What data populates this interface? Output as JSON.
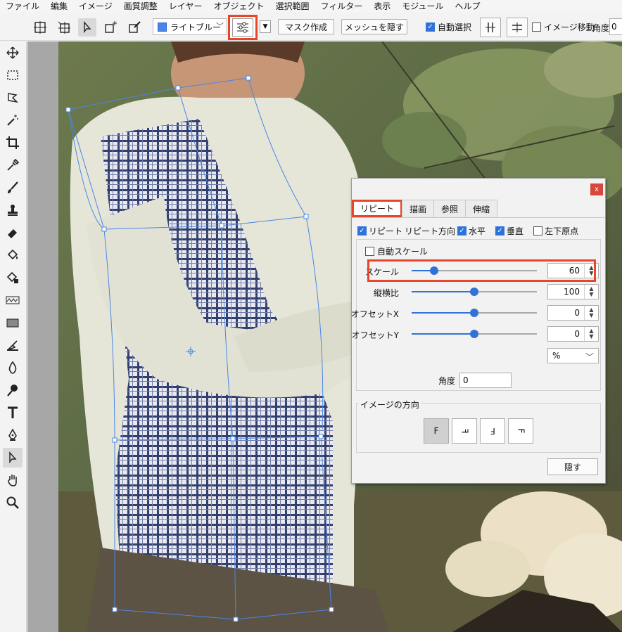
{
  "menu": [
    "ファイル",
    "編集",
    "イメージ",
    "画質調整",
    "レイヤー",
    "オブジェクト",
    "選択範囲",
    "フィルター",
    "表示",
    "モジュール",
    "ヘルプ"
  ],
  "toolbar": {
    "color_label": "ライトブルー",
    "color_value": "#4a86e8",
    "mask_button": "マスク作成",
    "mesh_button": "メッシュを隠す",
    "auto_select_label": "自動選択",
    "image_move_label": "イメージ移動",
    "angle_label": "角度",
    "angle_value": "0"
  },
  "dialog": {
    "close_glyph": "x",
    "tabs": [
      "リピート",
      "描画",
      "参照",
      "伸縮"
    ],
    "repeat_label": "リピート",
    "repeat_dir_label": "リピート方向",
    "horizontal_label": "水平",
    "vertical_label": "垂直",
    "bottom_left_label": "左下原点",
    "auto_scale_label": "自動スケール",
    "sliders": [
      {
        "label": "スケール",
        "value": "60",
        "level": 0.18
      },
      {
        "label": "縦横比",
        "value": "100",
        "level": 0.5
      },
      {
        "label": "オフセットX",
        "value": "0",
        "level": 0.5
      },
      {
        "label": "オフセットY",
        "value": "0",
        "level": 0.5
      }
    ],
    "unit": "%",
    "angle_label": "角度",
    "angle_value": "0",
    "orientation_label": "イメージの方向",
    "orientation_glyphs": [
      "F",
      "F",
      "F",
      "F"
    ],
    "hide_button": "隠す"
  },
  "colors": {
    "accent": "#2f73d9",
    "highlight": "#e8452b",
    "mesh": "#4a86e8"
  }
}
